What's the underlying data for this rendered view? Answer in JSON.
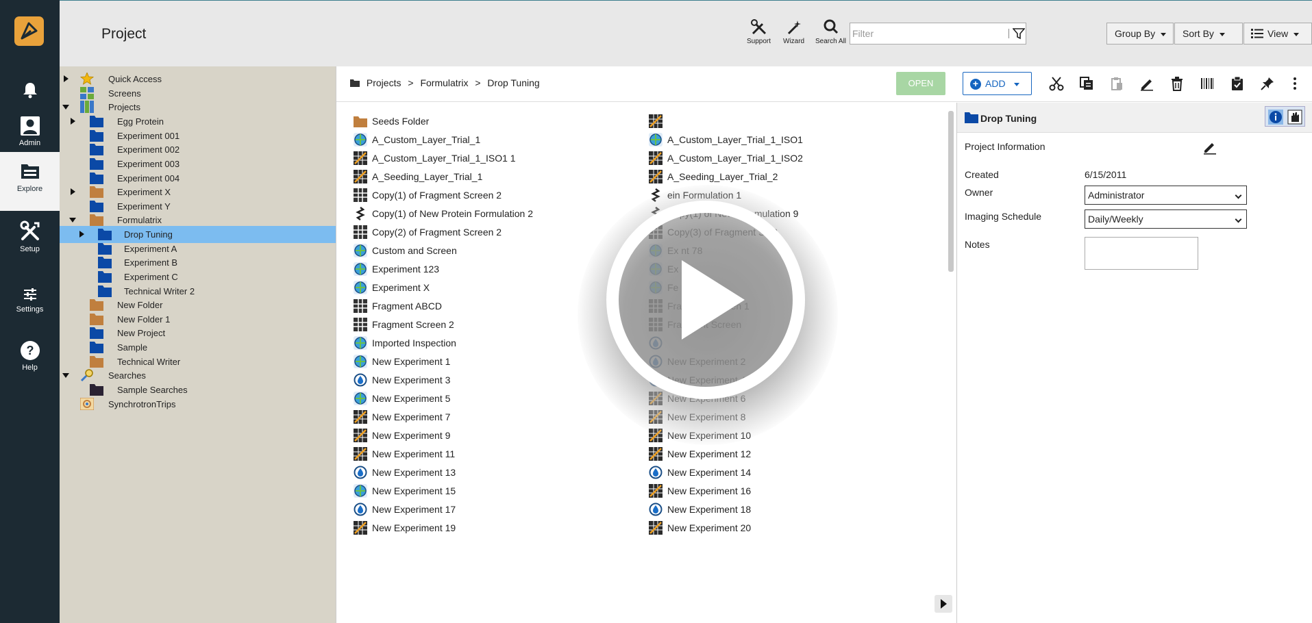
{
  "nav": {
    "items": [
      {
        "label": ""
      },
      {
        "label": "Admin"
      },
      {
        "label": "Explore"
      },
      {
        "label": "Setup"
      },
      {
        "label": "Settings"
      },
      {
        "label": "Help"
      }
    ]
  },
  "header": {
    "title": "Project",
    "tools": [
      {
        "label": "Support"
      },
      {
        "label": "Wizard"
      },
      {
        "label": "Search All"
      }
    ],
    "filter_placeholder": "Filter",
    "group_by": "Group By",
    "sort_by": "Sort By",
    "view": "View"
  },
  "tree": {
    "items": [
      {
        "label": "Quick Access"
      },
      {
        "label": "Screens"
      },
      {
        "label": "Projects"
      },
      {
        "label": "Egg Protein"
      },
      {
        "label": "Experiment 001"
      },
      {
        "label": "Experiment 002"
      },
      {
        "label": "Experiment 003"
      },
      {
        "label": "Experiment 004"
      },
      {
        "label": "Experiment X"
      },
      {
        "label": "Experiment Y"
      },
      {
        "label": "Formulatrix"
      },
      {
        "label": "Drop Tuning"
      },
      {
        "label": "Experiment A"
      },
      {
        "label": "Experiment B"
      },
      {
        "label": "Experiment C"
      },
      {
        "label": "Technical Writer 2"
      },
      {
        "label": "New Folder"
      },
      {
        "label": "New Folder 1"
      },
      {
        "label": "New Project"
      },
      {
        "label": "Sample"
      },
      {
        "label": "Technical Writer"
      },
      {
        "label": "Searches"
      },
      {
        "label": "Sample Searches"
      },
      {
        "label": "SynchrotronTrips"
      }
    ]
  },
  "toolbar": {
    "breadcrumb": [
      "Projects",
      ">",
      "Formulatrix",
      ">",
      "Drop Tuning"
    ],
    "open_label": "OPEN",
    "add_label": "ADD"
  },
  "files": {
    "left": [
      "Seeds Folder",
      "A_Custom_Layer_Trial_1",
      "A_Custom_Layer_Trial_1_ISO1 1",
      "A_Seeding_Layer_Trial_1",
      "Copy(1) of Fragment Screen 2",
      "Copy(1) of New Protein Formulation 2",
      "Copy(2) of Fragment Screen 2",
      "Custom and Screen",
      "Experiment 123",
      "Experiment X",
      "Fragment ABCD",
      "Fragment Screen 2",
      "Imported Inspection",
      "New Experiment 1",
      "New Experiment 3",
      "New Experiment 5",
      "New Experiment 7",
      "New Experiment 9",
      "New Experiment 11",
      "New Experiment 13",
      "New Experiment 15",
      "New Experiment 17",
      "New Experiment 19"
    ],
    "right": [
      "",
      "A_Custom_Layer_Trial_1_ISO1",
      "A_Custom_Layer_Trial_1_ISO2",
      "A_Seeding_Layer_Trial_2",
      "ein Formulation 1",
      "Copy(1) of New Pro      mulation 9",
      "Copy(3) of Fragment Sc      2",
      "Ex      nt 78",
      "Ex",
      "Fe",
      "Fragment Screen 1",
      "Fragment Screen",
      "",
      "New Experiment 2",
      "New Experiment 4",
      "New Experiment 6",
      "New Experiment 8",
      "New Experiment 10",
      "New Experiment 12",
      "New Experiment 14",
      "New Experiment 16",
      "New Experiment 18",
      "New Experiment 20"
    ]
  },
  "details": {
    "title": "Drop Tuning",
    "section": "Project Information",
    "created_label": "Created",
    "created_value": "6/15/2011",
    "owner_label": "Owner",
    "owner_value": "Administrator",
    "schedule_label": "Imaging Schedule",
    "schedule_value": "Daily/Weekly",
    "notes_label": "Notes"
  },
  "colors": {
    "nav_bg": "#1c2a33",
    "logo": "#e9a23b",
    "tree_bg": "#d8d4c8",
    "selected": "#7cbcf0",
    "accent": "#1565c0",
    "open_btn": "#a8d6a4"
  }
}
